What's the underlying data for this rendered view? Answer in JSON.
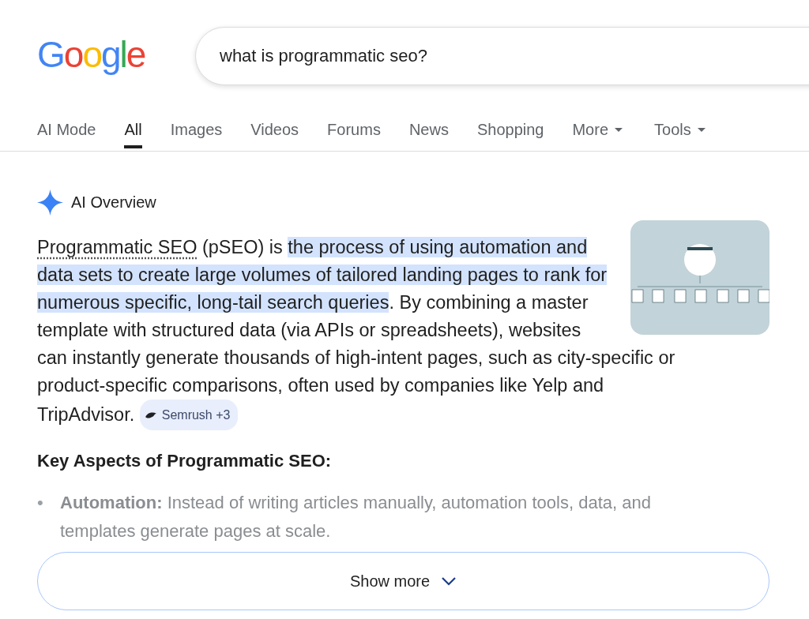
{
  "logo": {
    "text": "Google"
  },
  "search": {
    "value": "what is programmatic seo?"
  },
  "tabs": [
    {
      "label": "AI Mode",
      "selected": false,
      "dropdown": false
    },
    {
      "label": "All",
      "selected": true,
      "dropdown": false
    },
    {
      "label": "Images",
      "selected": false,
      "dropdown": false
    },
    {
      "label": "Videos",
      "selected": false,
      "dropdown": false
    },
    {
      "label": "Forums",
      "selected": false,
      "dropdown": false
    },
    {
      "label": "News",
      "selected": false,
      "dropdown": false
    },
    {
      "label": "Shopping",
      "selected": false,
      "dropdown": false
    },
    {
      "label": "More",
      "selected": false,
      "dropdown": true
    },
    {
      "label": "Tools",
      "selected": false,
      "dropdown": true
    }
  ],
  "ai_overview": {
    "title": "AI Overview",
    "paragraph": [
      {
        "kind": "link",
        "text": "Programmatic SEO"
      },
      {
        "kind": "plain",
        "text": " (pSEO) is "
      },
      {
        "kind": "highlight",
        "text": "the process of using automation and data sets to create large volumes of tailored landing pages to rank for numerous specific, long-tail search queries"
      },
      {
        "kind": "plain",
        "text": ". By combining a master template with structured data (via APIs or spreadsheets), websites can instantly generate thousands of high-intent pages, such as city-specific or product-specific comparisons, often used by companies like Yelp and TripAdvisor."
      }
    ],
    "source_chip": "Semrush +3",
    "heading": "Key Aspects of Programmatic SEO:",
    "bullets": [
      {
        "marker": "•",
        "term": "Automation:",
        "text": " Instead of writing articles manually, automation tools, data, and templates generate pages at scale."
      }
    ],
    "show_more": "Show more"
  }
}
